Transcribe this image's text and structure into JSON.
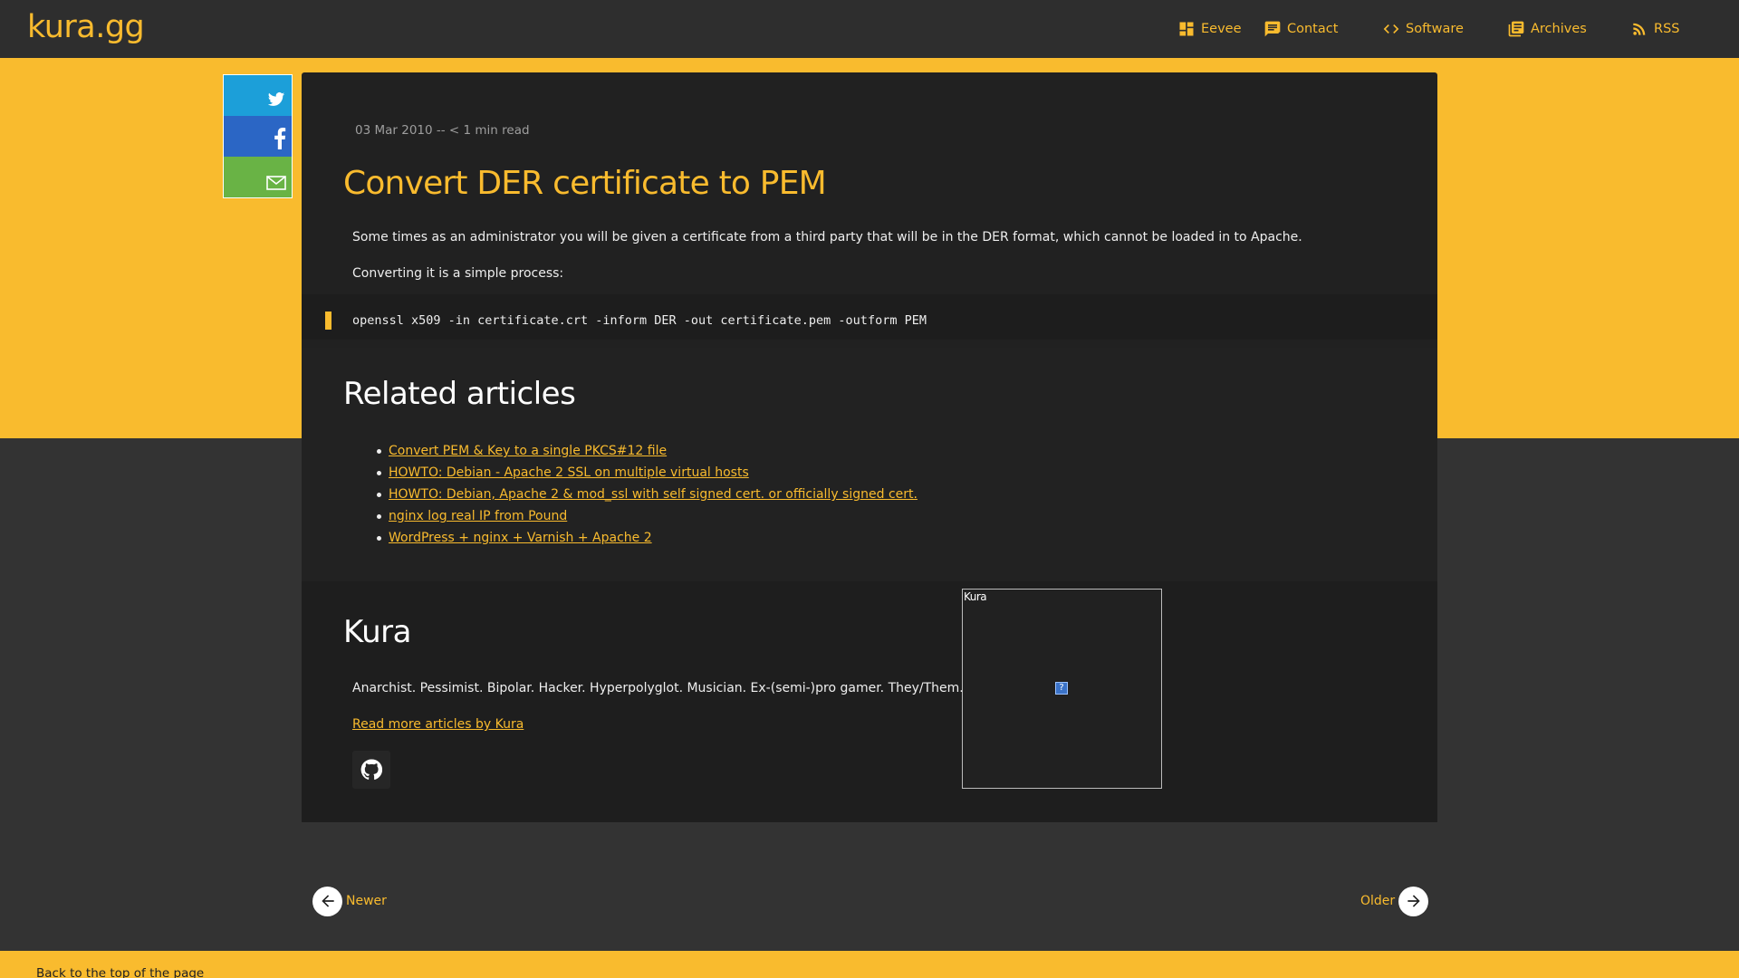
{
  "header": {
    "brand": "kura.gg",
    "nav": [
      {
        "label": "Eevee",
        "icon": "dashboard-icon"
      },
      {
        "label": "Contact",
        "icon": "chat-icon"
      },
      {
        "label": "Software",
        "icon": "code-icon"
      },
      {
        "label": "Archives",
        "icon": "library-icon"
      },
      {
        "label": "RSS",
        "icon": "rss-icon"
      }
    ]
  },
  "share": {
    "twitter_icon": "twitter-icon",
    "facebook_icon": "facebook-icon",
    "email_icon": "email-icon"
  },
  "article": {
    "meta": "03 Mar 2010 -- < 1 min read",
    "title": "Convert DER certificate to PEM",
    "para1": "Some times as an administrator you will be given a certificate from a third party that will be in the DER format, which cannot be loaded in to Apache.",
    "para2": "Converting it is a simple process:",
    "code": "openssl x509 -in certificate.crt -inform DER -out certificate.pem -outform PEM"
  },
  "related": {
    "heading": "Related articles",
    "items": [
      "Convert PEM & Key to a single PKCS#12 file",
      "HOWTO: Debian - Apache 2 SSL on multiple virtual hosts",
      "HOWTO: Debian, Apache 2 & mod_ssl with self signed cert. or officially signed cert.",
      "nginx log real IP from Pound",
      "WordPress + nginx + Varnish + Apache 2"
    ]
  },
  "author": {
    "name": "Kura",
    "bio": "Anarchist. Pessimist. Bipolar. Hacker. Hyperpolyglot. Musician. Ex-(semi-)pro gamer. They/Them.",
    "read_more": "Read more articles by Kura",
    "avatar_alt": "Kura",
    "github_icon": "github-icon"
  },
  "pager": {
    "newer": "Newer",
    "older": "Older"
  },
  "footer": {
    "back_to_top": "Back to the top of the page"
  },
  "colors": {
    "accent": "#f9bb2e",
    "background": "#333333",
    "card": "#212121",
    "twitter": "#1c9fd9",
    "facebook": "#2b66c5",
    "email": "#69b345"
  }
}
